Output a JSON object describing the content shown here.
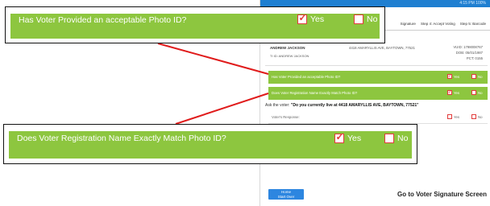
{
  "screen": {
    "status_text": "4:15 PM 100%",
    "tabs": [
      "Signature",
      "Step 4: Accept Voting",
      "Step 5: Barcode"
    ],
    "voter": {
      "name": "ANDREW JACKSON",
      "ti_line": "TI ID: ANDREW JACKSON",
      "address": "4418 AMARYLLIS AVE, BAYTOWN, 77521",
      "vuid": "VUID: 1798008767",
      "dob": "DOB: 05/01/1987",
      "pct": "PCT: 0155"
    },
    "rows": [
      {
        "question": "Has Voter Provided an acceptable Photo ID?",
        "yes": "Yes",
        "no": "No"
      },
      {
        "question": "Does Voter Registration Name Exactly Match Photo ID?",
        "yes": "Yes",
        "no": "No"
      },
      {
        "question": "Voter's Response:",
        "yes": "Yes",
        "no": "No"
      }
    ],
    "ask_prefix": "Ask the voter:",
    "ask_question": "\"Do you currently live at 4418 AMARYLLIS AVE, BAYTOWN, 77521\"",
    "home_button": "Home",
    "home_sub": "Start Over",
    "go_signature": "Go to Voter Signature Screen"
  },
  "callout_1": {
    "question": "Has Voter Provided an acceptable Photo ID?",
    "yes_label": "Yes",
    "no_label": "No",
    "yes_checked": true,
    "no_checked": false
  },
  "callout_2": {
    "question": "Does Voter Registration Name Exactly Match Photo ID?",
    "yes_label": "Yes",
    "no_label": "No",
    "yes_checked": true,
    "no_checked": false
  },
  "colors": {
    "accent_green": "#8dc63f",
    "checkbox_red": "#e23b3b",
    "leader_red": "#e01b1b",
    "button_blue": "#2d86e0",
    "status_blue": "#1f7fd1"
  },
  "icons": {
    "checkmark": "check-icon"
  }
}
